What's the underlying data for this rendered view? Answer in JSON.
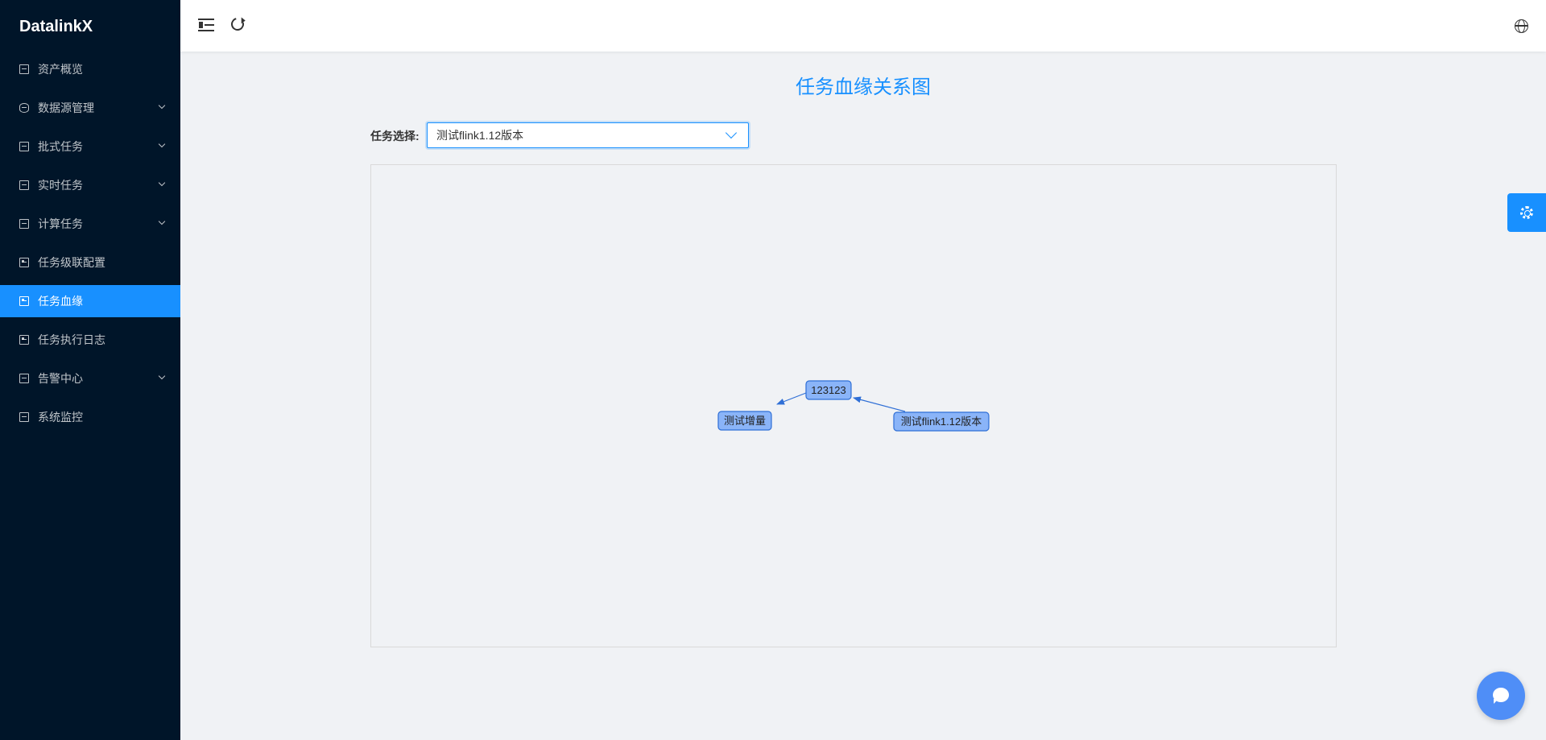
{
  "app": {
    "brand": "DatalinkX"
  },
  "sidebar": {
    "items": [
      {
        "label": "资产概览",
        "icon": "overview-icon",
        "expandable": false,
        "active": false
      },
      {
        "label": "数据源管理",
        "icon": "datasource-icon",
        "expandable": true,
        "active": false
      },
      {
        "label": "批式任务",
        "icon": "batch-task-icon",
        "expandable": true,
        "active": false
      },
      {
        "label": "实时任务",
        "icon": "realtime-task-icon",
        "expandable": true,
        "active": false
      },
      {
        "label": "计算任务",
        "icon": "compute-task-icon",
        "expandable": true,
        "active": false
      },
      {
        "label": "任务级联配置",
        "icon": "cascade-config-icon",
        "expandable": false,
        "active": false
      },
      {
        "label": "任务血缘",
        "icon": "lineage-icon",
        "expandable": false,
        "active": true
      },
      {
        "label": "任务执行日志",
        "icon": "log-icon",
        "expandable": false,
        "active": false
      },
      {
        "label": "告警中心",
        "icon": "alarm-icon",
        "expandable": true,
        "active": false
      },
      {
        "label": "系统监控",
        "icon": "monitor-icon",
        "expandable": false,
        "active": false
      }
    ]
  },
  "header": {
    "icons": [
      "menu-fold-icon",
      "reload-icon",
      "globe-icon"
    ]
  },
  "main": {
    "title": "任务血缘关系图",
    "task_select": {
      "label": "任务选择:",
      "value": "测试flink1.12版本"
    },
    "graph": {
      "nodes": [
        {
          "id": "n1",
          "label": "123123"
        },
        {
          "id": "n2",
          "label": "测试增量"
        },
        {
          "id": "n3",
          "label": "测试flink1.12版本"
        }
      ],
      "edges": [
        {
          "from": "n1",
          "to": "n2"
        },
        {
          "from": "n3",
          "to": "n1"
        }
      ]
    }
  },
  "floating": {
    "settings_icon": "gear-icon",
    "chat_icon": "chat-icon"
  },
  "colors": {
    "sidebar_bg": "#001529",
    "accent": "#1890ff",
    "node_fill": "#8ab4f8",
    "node_stroke": "#2f6fd6"
  }
}
